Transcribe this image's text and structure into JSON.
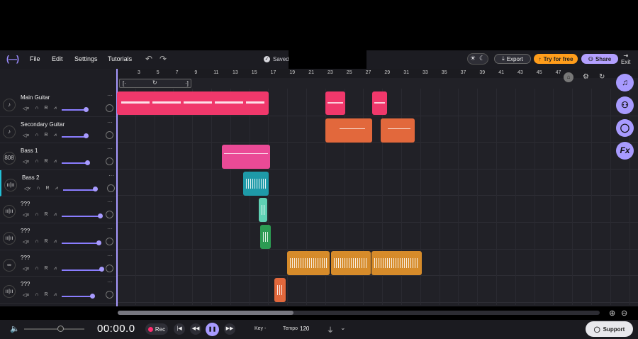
{
  "menu": {
    "logo": "(—)",
    "file": "File",
    "edit": "Edit",
    "settings": "Settings",
    "tutorials": "Tutorials"
  },
  "status": {
    "saved": "Saved!"
  },
  "header_buttons": {
    "export": "Export",
    "try_free": "Try for free",
    "share": "Share",
    "exit": "Exit"
  },
  "ruler": [
    "3",
    "5",
    "7",
    "9",
    "11",
    "13",
    "15",
    "17",
    "19",
    "21",
    "23",
    "25",
    "27",
    "29",
    "31",
    "33",
    "35",
    "37",
    "39",
    "41",
    "43",
    "45",
    "47"
  ],
  "tracks": [
    {
      "name": "Main Guitar",
      "icon": "guitar-icon",
      "glyph": "♪",
      "volume": 0.38
    },
    {
      "name": "Secondary Guitar",
      "icon": "guitar-icon",
      "glyph": "♪",
      "volume": 0.38
    },
    {
      "name": "Bass 1",
      "icon": "drum-machine-icon",
      "glyph": "808",
      "volume": 0.4
    },
    {
      "name": "Bass 2",
      "icon": "waveform-icon",
      "glyph": "ıı|ıı",
      "volume": 0.5
    },
    {
      "name": "???",
      "icon": "waveform-icon",
      "glyph": "ıı|ıı",
      "volume": 0.6
    },
    {
      "name": "???",
      "icon": "waveform-icon",
      "glyph": "ıı|ıı",
      "volume": 0.58
    },
    {
      "name": "???",
      "icon": "link-icon",
      "glyph": "∞",
      "volume": 0.62
    },
    {
      "name": "???",
      "icon": "waveform-icon",
      "glyph": "ıı|ıı",
      "volume": 0.48
    }
  ],
  "track_controls": {
    "mute": "◁×",
    "headphones": "∩",
    "record": "R",
    "automation": "⩘"
  },
  "colors": {
    "accent": "#a89bff",
    "pink": "#f0386b",
    "orange": "#e2683c",
    "magenta": "#ea4a96",
    "teal": "#1e9aa8",
    "mint": "#5fd0b3",
    "green": "#2c9b53",
    "amber": "#d68b2a"
  },
  "transport": {
    "time": "00:00.0",
    "rec": "Rec",
    "key_label": "Key",
    "key_value": "-",
    "tempo_label": "Tempo",
    "tempo_value": "120",
    "support": "Support"
  }
}
